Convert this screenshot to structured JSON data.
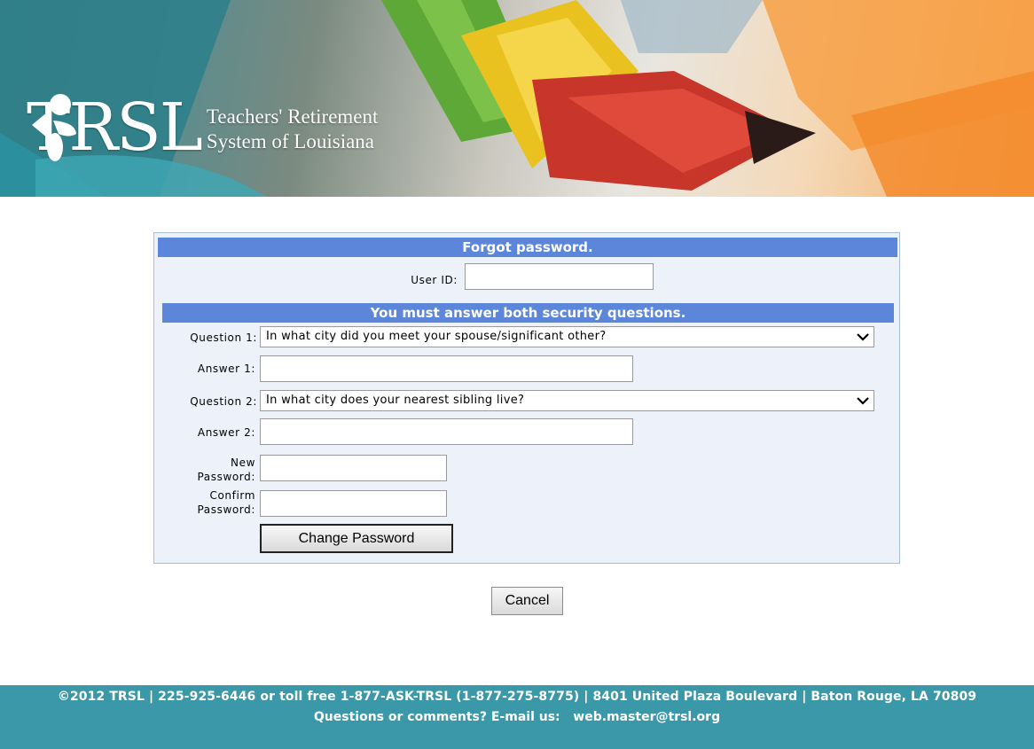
{
  "header": {
    "logo_wordmark": "TRSL",
    "logo_line1": "Teachers' Retirement",
    "logo_line2": "System of Louisiana"
  },
  "form": {
    "title": "Forgot password.",
    "user_id_label": "User ID:",
    "user_id_value": "",
    "security_heading": "You must answer both security questions.",
    "question1_label": "Question 1:",
    "question1_selected": "In what city did you meet your spouse/significant other?",
    "answer1_label": "Answer 1:",
    "answer1_value": "",
    "question2_label": "Question 2:",
    "question2_selected": "In what city does your nearest sibling live?",
    "answer2_label": "Answer 2:",
    "answer2_value": "",
    "new_password_label_1": "New",
    "new_password_label_2": "Password:",
    "confirm_password_label_1": "Confirm",
    "confirm_password_label_2": "Password:",
    "change_password_button": "Change Password",
    "cancel_button": "Cancel"
  },
  "footer": {
    "line1": "©2012 TRSL | 225-925-6446 or toll free 1-877-ASK-TRSL (1-877-275-8775) | 8401 United Plaza Boulevard | Baton Rouge, LA 70809",
    "line2_prefix": "Questions or comments? E-mail us:",
    "email": "web.master@trsl.org"
  },
  "icons": {
    "logo": "trsl-logo-icon",
    "dropdown": "chevron-down-icon"
  },
  "colors": {
    "panel_header": "#5b86d9",
    "panel_bg": "#edf2fa",
    "footer_bg": "#3a98a8"
  }
}
